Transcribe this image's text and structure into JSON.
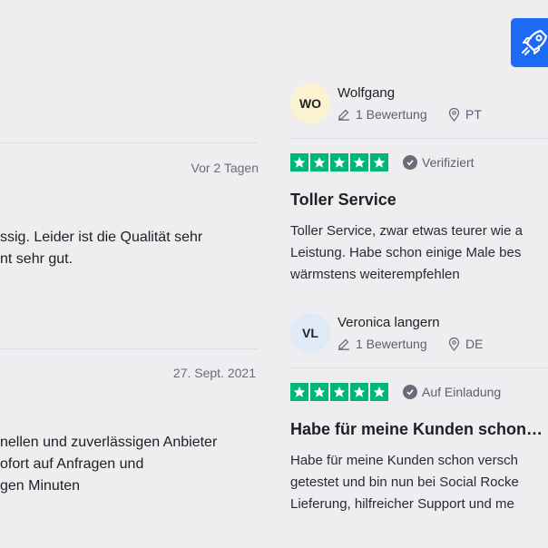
{
  "left": {
    "review1": {
      "date": "Vor 2 Tagen",
      "lines": [
        "ssig. Leider ist die Qualität sehr",
        "nt sehr gut."
      ]
    },
    "review2": {
      "date": "27. Sept. 2021",
      "lines": [
        "nellen und zuverlässigen Anbieter",
        "ofort auf Anfragen und",
        "gen Minuten"
      ]
    }
  },
  "right": {
    "reviews": [
      {
        "initials": "WO",
        "avatar_color": "#fbf3cf",
        "name": "Wolfgang",
        "review_count": "1 Bewertung",
        "country": "PT",
        "badge": "Verifiziert",
        "title": "Toller Service",
        "lines": [
          "Toller Service, zwar etwas teurer wie a",
          "Leistung. Habe schon einige Male bes",
          "wärmstens weiterempfehlen"
        ]
      },
      {
        "initials": "VL",
        "avatar_color": "#dfe9f7",
        "name": "Veronica langern",
        "review_count": "1 Bewertung",
        "country": "DE",
        "badge": "Auf Einladung",
        "title": "Habe für meine Kunden schon…",
        "lines": [
          "Habe für meine Kunden schon versch",
          "getestet und bin nun bei Social Rocke",
          "Lieferung, hilfreicher Support und me"
        ]
      }
    ]
  },
  "colors": {
    "star_green": "#00b67a",
    "brand_blue": "#1c6af6"
  },
  "icons": {
    "rocket": "rocket-icon",
    "pencil": "pencil-icon",
    "location": "location-pin-icon",
    "star": "star-icon",
    "check": "check-circle-icon"
  }
}
